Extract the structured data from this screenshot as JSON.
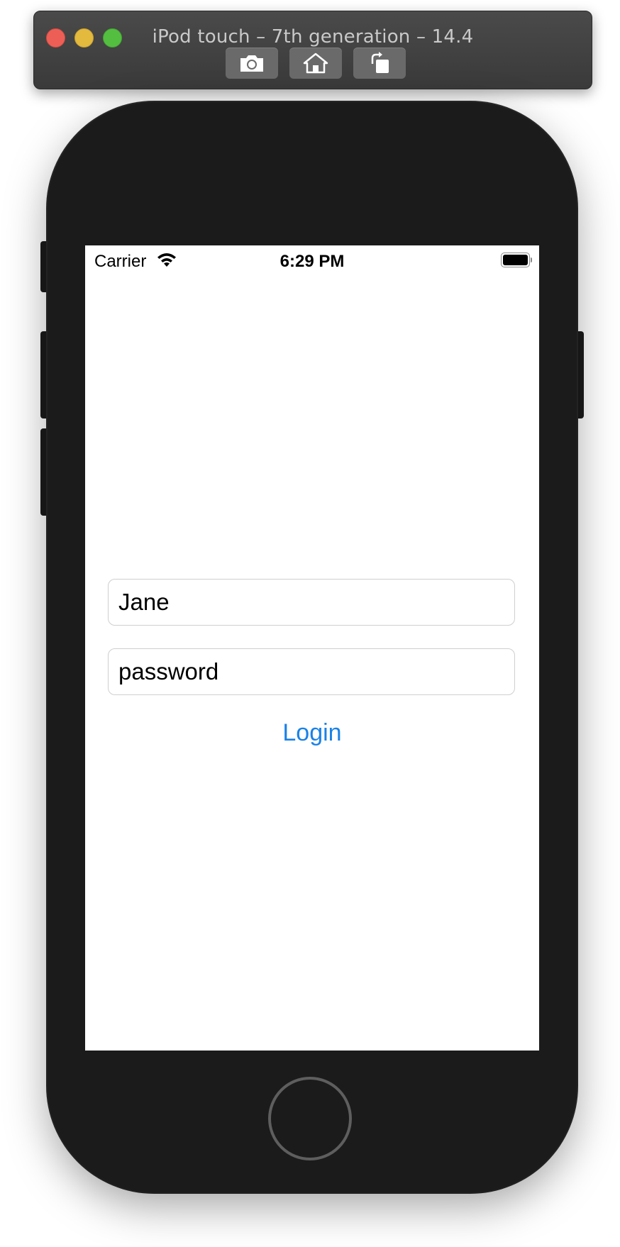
{
  "window": {
    "title": "iPod touch – 7th generation – 14.4",
    "toolbar": [
      {
        "icon": "camera-icon"
      },
      {
        "icon": "home-icon"
      },
      {
        "icon": "rotate-icon"
      }
    ]
  },
  "status_bar": {
    "carrier": "Carrier",
    "time": "6:29 PM",
    "battery_level": 1.0
  },
  "form": {
    "username_value": "Jane",
    "password_value": "password",
    "login_label": "Login"
  },
  "colors": {
    "accent": "#1a82e6",
    "device_body": "#1b1b1b"
  }
}
